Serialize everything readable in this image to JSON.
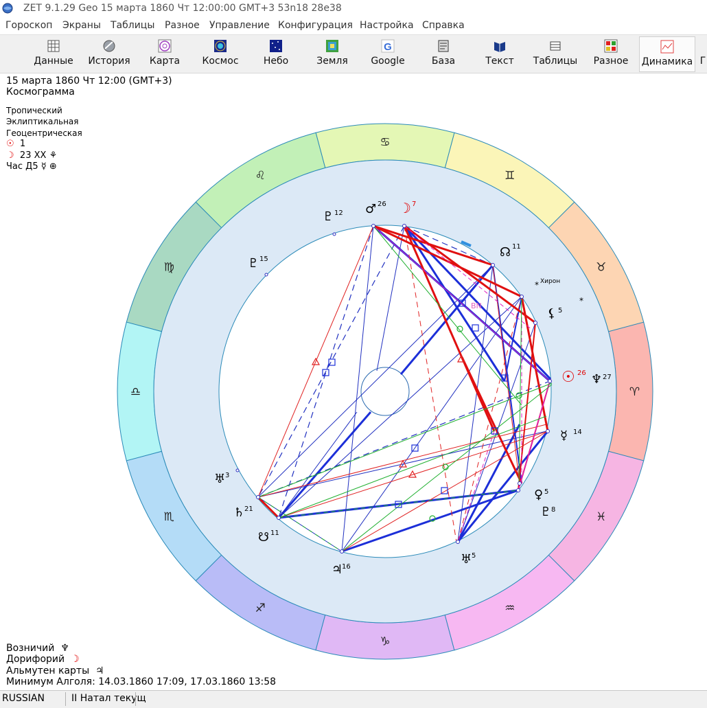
{
  "window": {
    "title": "ZET 9.1.29 Geo   15 марта 1860  Чт  12:00:00 GMT+3 53n18  28e38"
  },
  "menu": [
    "Гороскоп",
    "Экраны",
    "Таблицы",
    "Разное",
    "Управление",
    "Конфигурация",
    "Настройка",
    "Справка"
  ],
  "toolbar": [
    {
      "label": "Данные",
      "icon": "data-table-icon"
    },
    {
      "label": "История",
      "icon": "history-icon"
    },
    {
      "label": "Карта",
      "icon": "chart-wheel-icon"
    },
    {
      "label": "Космос",
      "icon": "cosmos-icon"
    },
    {
      "label": "Небо",
      "icon": "sky-icon"
    },
    {
      "label": "Земля",
      "icon": "earth-icon"
    },
    {
      "label": "Google",
      "icon": "google-icon"
    },
    {
      "label": "База",
      "icon": "database-icon"
    },
    {
      "label": "Текст",
      "icon": "text-book-icon"
    },
    {
      "label": "Таблицы",
      "icon": "tables-icon"
    },
    {
      "label": "Разное",
      "icon": "misc-icon"
    },
    {
      "label": "Динамика",
      "icon": "dynamics-icon",
      "active": true
    }
  ],
  "toolbar_overflow": "Г",
  "info": {
    "date_line": "15 марта 1860  Чт  12:00 (GMT+3)",
    "chart_type": "Космограмма",
    "zodiac": "Тропический",
    "coords": "Эклиптикальная",
    "center": "Геоцентрическая",
    "sun_line": "1",
    "moon_line": "23 XX",
    "hour_line": "Час Д5"
  },
  "bottom_info": {
    "auriga_label": "Возничий",
    "doryphory_label": "Дорифорий",
    "almuten_label": "Альмутен карты",
    "algol_label": "Минимум Алголя: 14.03.1860 17:09,  17.03.1860 13:58"
  },
  "status": {
    "language": "RUSSIAN",
    "mode": "II Натал текущ"
  },
  "zodiac_signs": [
    {
      "glyph": "♈",
      "name": "aries",
      "color": "#fbb6b0"
    },
    {
      "glyph": "♉",
      "name": "taurus",
      "color": "#fdd5b3"
    },
    {
      "glyph": "♊",
      "name": "gemini",
      "color": "#fbf5b8"
    },
    {
      "glyph": "♋",
      "name": "cancer",
      "color": "#e4f7b5"
    },
    {
      "glyph": "♌",
      "name": "leo",
      "color": "#c2f0b7"
    },
    {
      "glyph": "♍",
      "name": "virgo",
      "color": "#a9d9c2"
    },
    {
      "glyph": "♎",
      "name": "libra",
      "color": "#b2f5f5"
    },
    {
      "glyph": "♏",
      "name": "scorpio",
      "color": "#b4dcf7"
    },
    {
      "glyph": "♐",
      "name": "sagittarius",
      "color": "#b9bcf7"
    },
    {
      "glyph": "♑",
      "name": "capricorn",
      "color": "#e0b8f5"
    },
    {
      "glyph": "♒",
      "name": "aquarius",
      "color": "#f7b8f2"
    },
    {
      "glyph": "♓",
      "name": "pisces",
      "color": "#f6b5e3"
    }
  ],
  "planets": [
    {
      "name": "sun",
      "glyph": "☉",
      "degree": "26",
      "color": "#e00000"
    },
    {
      "name": "neptune",
      "glyph": "♆",
      "degree": "27",
      "color": "#000000"
    },
    {
      "name": "mercury",
      "glyph": "☿",
      "degree": "14",
      "color": "#000000"
    },
    {
      "name": "venus",
      "glyph": "♀",
      "degree": "5",
      "color": "#000000"
    },
    {
      "name": "pluto",
      "glyph": "♇",
      "degree": "8",
      "color": "#000000"
    },
    {
      "name": "uranus",
      "glyph": "♅",
      "degree": "5",
      "color": "#000000"
    },
    {
      "name": "jupiter",
      "glyph": "♃",
      "degree": "16",
      "color": "#000000"
    },
    {
      "name": "south-node",
      "glyph": "☋",
      "degree": "11",
      "color": "#000000"
    },
    {
      "name": "saturn",
      "glyph": "♄",
      "degree": "21",
      "color": "#000000"
    },
    {
      "name": "chiron-like",
      "glyph": "♅",
      "degree": "3",
      "color": "#000000"
    },
    {
      "name": "proserpina",
      "glyph": "♇",
      "degree": "15",
      "color": "#000000"
    },
    {
      "name": "pluto-2",
      "glyph": "♇",
      "degree": "12",
      "color": "#000000"
    },
    {
      "name": "mars",
      "glyph": "♂",
      "degree": "26",
      "color": "#000000"
    },
    {
      "name": "moon",
      "glyph": "☽",
      "degree": "7",
      "color": "#e00000"
    },
    {
      "name": "north-node",
      "glyph": "☊",
      "degree": "11",
      "color": "#000000"
    },
    {
      "name": "lilith",
      "glyph": "⚸",
      "degree": "5",
      "color": "#000000"
    }
  ],
  "chiron_label": "Хирон",
  "aspect_label": "BN"
}
